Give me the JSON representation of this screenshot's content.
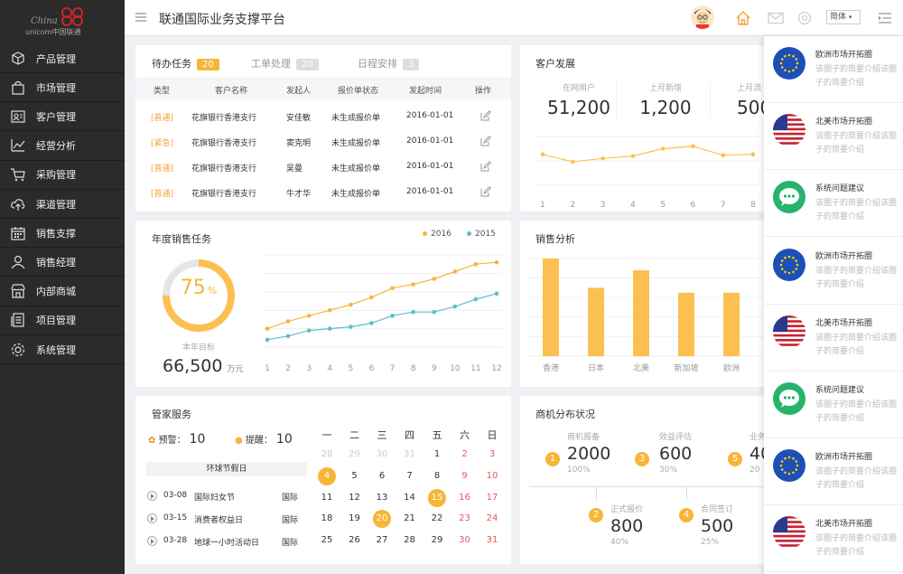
{
  "app": {
    "title": "联通国际业务支撑平台",
    "logo_text_1": "China",
    "logo_text_2": "unicom中国联通",
    "lang": "简体"
  },
  "sidebar": {
    "items": [
      {
        "label": "产品管理",
        "icon": "cube-icon"
      },
      {
        "label": "市场管理",
        "icon": "bag-icon"
      },
      {
        "label": "客户管理",
        "icon": "contact-card-icon"
      },
      {
        "label": "经营分析",
        "icon": "trend-icon"
      },
      {
        "label": "采购管理",
        "icon": "cart-icon"
      },
      {
        "label": "渠道管理",
        "icon": "cloud-upload-icon"
      },
      {
        "label": "销售支撑",
        "icon": "calendar-icon"
      },
      {
        "label": "销售经理",
        "icon": "user-icon"
      },
      {
        "label": "内部商城",
        "icon": "store-icon"
      },
      {
        "label": "项目管理",
        "icon": "document-icon"
      },
      {
        "label": "系统管理",
        "icon": "gear-icon"
      }
    ]
  },
  "tasks": {
    "tabs": [
      {
        "label": "待办任务",
        "count": "20"
      },
      {
        "label": "工单处理",
        "count": "20"
      },
      {
        "label": "日程安排",
        "count": "3"
      }
    ],
    "columns": [
      "类型",
      "客户名称",
      "发起人",
      "报价单状态",
      "发起时间",
      "操作"
    ],
    "rows": [
      {
        "type": "[普通]",
        "customer": "花旗银行香港支行",
        "initiator": "安佳敏",
        "status": "未生成报价单",
        "date": "2016-01-01"
      },
      {
        "type": "[紧急]",
        "customer": "花旗银行香港支行",
        "initiator": "窦克明",
        "status": "未生成报价单",
        "date": "2016-01-01"
      },
      {
        "type": "[普通]",
        "customer": "花旗银行香港支行",
        "initiator": "吴曼",
        "status": "未生成报价单",
        "date": "2016-01-01"
      },
      {
        "type": "[普通]",
        "customer": "花旗银行香港支行",
        "initiator": "牛才华",
        "status": "未生成报价单",
        "date": "2016-01-01"
      }
    ]
  },
  "customer_dev": {
    "title": "客户发展",
    "stats": [
      {
        "label": "在网用户",
        "value": "51,200"
      },
      {
        "label": "上月新增",
        "value": "1,200"
      },
      {
        "label": "上月流",
        "value": "500"
      }
    ]
  },
  "annual_sales": {
    "title": "年度销售任务",
    "percent": "75",
    "percent_unit": "%",
    "target_label": "本年目标",
    "target_value": "66,500",
    "target_unit": "万元"
  },
  "sales_analysis": {
    "title": "销售分析"
  },
  "steward": {
    "title": "管家服务",
    "warning_label": "预警：",
    "warning_value": "10",
    "remind_label": "提醒：",
    "remind_value": "10",
    "holiday_title": "环球节假日",
    "holidays": [
      {
        "date": "03-08",
        "name": "国际妇女节",
        "scope": "国际"
      },
      {
        "date": "03-15",
        "name": "消费者权益日",
        "scope": "国际"
      },
      {
        "date": "03-28",
        "name": "地球一小时活动日",
        "scope": "国际"
      }
    ],
    "calendar": {
      "weekdays": [
        "一",
        "二",
        "三",
        "四",
        "五",
        "六",
        "日"
      ],
      "weeks": [
        [
          "28",
          "29",
          "30",
          "31",
          "1",
          "2",
          "3"
        ],
        [
          "4",
          "5",
          "6",
          "7",
          "8",
          "9",
          "10"
        ],
        [
          "11",
          "12",
          "13",
          "14",
          "15",
          "16",
          "17"
        ],
        [
          "18",
          "19",
          "20",
          "21",
          "22",
          "23",
          "24"
        ],
        [
          "25",
          "26",
          "27",
          "28",
          "29",
          "30",
          "31"
        ]
      ],
      "marked": [
        "4",
        "15",
        "20"
      ]
    }
  },
  "biz_distribution": {
    "title": "商机分布状况",
    "items": [
      {
        "num": "1",
        "label": "商机报备",
        "value": "2000",
        "pct": "100%"
      },
      {
        "num": "2",
        "label": "正式报价",
        "value": "800",
        "pct": "40%"
      },
      {
        "num": "3",
        "label": "效益评估",
        "value": "600",
        "pct": "30%"
      },
      {
        "num": "4",
        "label": "合同签订",
        "value": "500",
        "pct": "25%"
      },
      {
        "num": "5",
        "label": "业务",
        "value": "40",
        "pct": "20"
      }
    ]
  },
  "side_panel": {
    "items": [
      {
        "title": "欧洲市场开拓圈",
        "desc": "该圈子的简要介绍该圈子的简要介绍",
        "icon": "eu-flag-icon"
      },
      {
        "title": "北美市场开拓圈",
        "desc": "该圈子的简要介绍该圈子的简要介绍",
        "icon": "us-flag-icon"
      },
      {
        "title": "系统问题建议",
        "desc": "该圈子的简要介绍该圈子的简要介绍",
        "icon": "chat-bubble-icon"
      },
      {
        "title": "欧洲市场开拓圈",
        "desc": "该圈子的简要介绍该圈子的简要介绍",
        "icon": "eu-flag-icon"
      },
      {
        "title": "北美市场开拓圈",
        "desc": "该圈子的简要介绍该圈子的简要介绍",
        "icon": "us-flag-icon"
      },
      {
        "title": "系统问题建议",
        "desc": "该圈子的简要介绍该圈子的简要介绍",
        "icon": "chat-bubble-icon"
      },
      {
        "title": "欧洲市场开拓圈",
        "desc": "该圈子的简要介绍该圈子的简要介绍",
        "icon": "eu-flag-icon"
      },
      {
        "title": "北美市场开拓圈",
        "desc": "该圈子的简要介绍该圈子的简要介绍",
        "icon": "us-flag-icon"
      }
    ]
  },
  "colors": {
    "accent": "#f7b538",
    "teal": "#5bc0c8",
    "sidebar": "#2b2b2b",
    "bar": "#fcc052"
  },
  "chart_data": [
    {
      "type": "line",
      "x": [
        "1",
        "2",
        "3",
        "4",
        "5",
        "6",
        "7",
        "8"
      ],
      "series": [
        {
          "name": "",
          "values": [
            38,
            29,
            33,
            36,
            45,
            48,
            37,
            38
          ]
        }
      ],
      "ylim": [
        0,
        60
      ]
    },
    {
      "type": "line",
      "x": [
        "1",
        "2",
        "3",
        "4",
        "5",
        "6",
        "7",
        "8",
        "9",
        "10",
        "11",
        "12"
      ],
      "series": [
        {
          "name": "2016",
          "values": [
            10,
            14,
            17,
            20,
            23,
            27,
            32,
            34,
            37,
            41,
            45,
            46
          ]
        },
        {
          "name": "2015",
          "values": [
            4,
            6,
            9,
            10,
            11,
            13,
            17,
            19,
            19,
            22,
            26,
            29
          ]
        }
      ],
      "ylim": [
        0,
        50
      ]
    },
    {
      "type": "bar",
      "categories": [
        "香港",
        "日本",
        "北美",
        "新加坡",
        "欧洲"
      ],
      "values": [
        100,
        70,
        88,
        65,
        65
      ],
      "ylim": [
        0,
        100
      ]
    }
  ]
}
